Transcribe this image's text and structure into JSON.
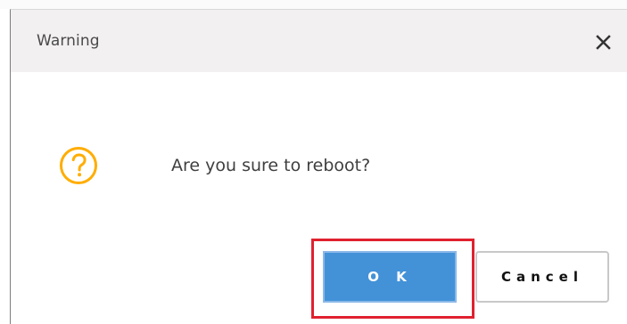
{
  "dialog": {
    "title": "Warning",
    "close_icon": "close-icon",
    "question_icon": "question-mark-circle-icon",
    "message": "Are you sure to reboot?",
    "ok_label": "O K",
    "cancel_label": "Cancel"
  },
  "colors": {
    "header_background": "#f3f0f1",
    "primary_button": "#4392d8",
    "question_icon": "#ffad00",
    "highlight": "#e0212f"
  }
}
